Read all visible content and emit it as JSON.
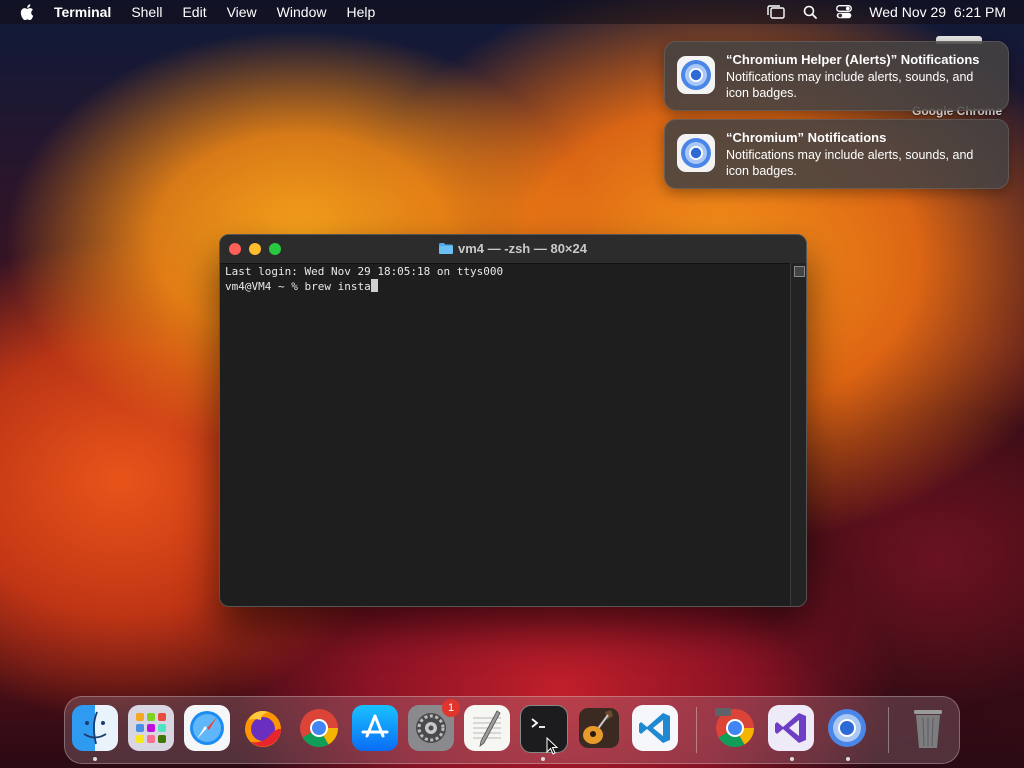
{
  "menubar": {
    "app_name": "Terminal",
    "items": [
      "Shell",
      "Edit",
      "View",
      "Window",
      "Help"
    ],
    "datetime": "Wed Nov 29  6:21 PM"
  },
  "notifications": [
    {
      "title": "“Chromium Helper (Alerts)” Notifications",
      "body": "Notifications may include alerts, sounds, and icon badges."
    },
    {
      "title": "“Chromium” Notifications",
      "body": "Notifications may include alerts, sounds, and icon badges."
    }
  ],
  "behind_window_label": "Google Chrome",
  "terminal": {
    "title": "vm4 — -zsh — 80×24",
    "lines": [
      "Last login: Wed Nov 29 18:05:18 on ttys000",
      "vm4@VM4 ~ % brew insta"
    ]
  },
  "dock": {
    "items": [
      "finder",
      "launchpad",
      "safari",
      "firefox",
      "chrome",
      "app-store",
      "system-settings",
      "textedit",
      "terminal",
      "garageband",
      "vscode",
      "chrome-dev",
      "visual-studio",
      "chromium",
      "trash"
    ],
    "settings_badge": "1"
  },
  "colors": {
    "close": "#ff5f57",
    "minimize": "#febc2e",
    "maximize": "#28c840",
    "badge": "#e0342c"
  }
}
